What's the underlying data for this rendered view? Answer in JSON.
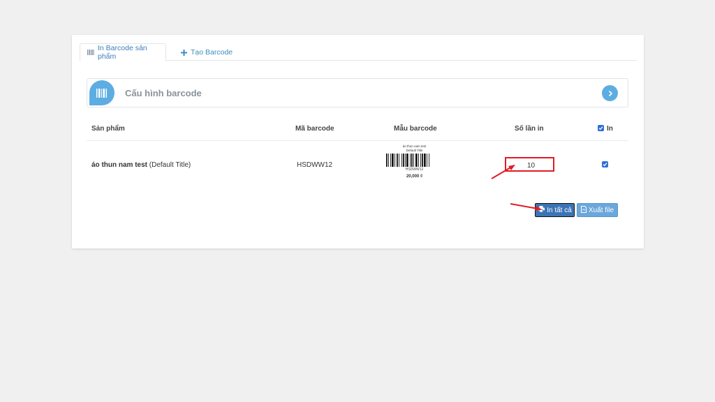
{
  "tabs": [
    {
      "label": "In Barcode sản phẩm",
      "icon": "barcode-icon",
      "active": true
    },
    {
      "label": "Tạo Barcode",
      "icon": "plus-icon",
      "active": false
    }
  ],
  "config": {
    "title": "Cấu hình barcode",
    "icon": "barcode-icon",
    "action_icon": "chevron-right-icon"
  },
  "table": {
    "headers": {
      "product": "Sản phẩm",
      "code": "Mã barcode",
      "sample": "Mẫu barcode",
      "count": "Số lần in",
      "print": "In"
    },
    "rows": [
      {
        "product_name": "áo thun nam test",
        "variant": " (Default Title)",
        "code": "HSDWW12",
        "sample": {
          "line1": "áo thun nam test",
          "line2": "Default Title",
          "code": "HSDWW12",
          "price": "20,000 ₫"
        },
        "count": "10",
        "checked": true
      }
    ]
  },
  "actions": {
    "print_all": "In tất cả",
    "export": "Xuất file"
  },
  "colors": {
    "accent": "#3c8dbc",
    "badge": "#5dade2",
    "primary_button": "#3b74b6",
    "export_button": "#6aa7db",
    "annotation": "#e01b24"
  }
}
